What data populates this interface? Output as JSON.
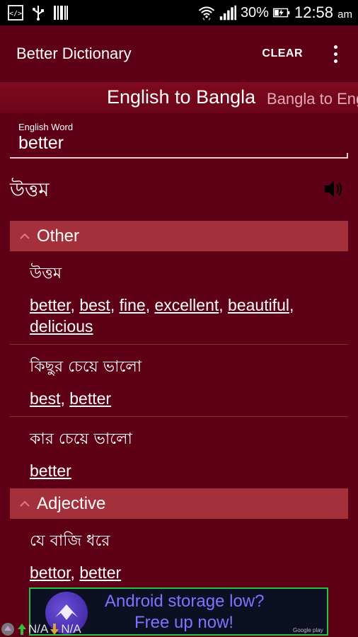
{
  "status_bar": {
    "battery": "30%",
    "time": "12:58",
    "ampm": "am"
  },
  "app_bar": {
    "title": "Better Dictionary",
    "clear_label": "CLEAR"
  },
  "tabs": {
    "active": "English to Bangla",
    "inactive": "Bangla to Eng"
  },
  "search": {
    "label": "English Word",
    "value": "better"
  },
  "main_meaning": "উত্তম",
  "sections": [
    {
      "title": "Other",
      "entries": [
        {
          "bn": "উত্তম",
          "en": [
            "better",
            "best",
            "fine",
            "excellent",
            "beautiful",
            "delicious"
          ]
        },
        {
          "bn": "কিছুর চেয়ে ভালো",
          "en": [
            "best",
            "better"
          ]
        },
        {
          "bn": "কার চেয়ে ভালো",
          "en": [
            "better"
          ]
        }
      ]
    },
    {
      "title": "Adjective",
      "entries": [
        {
          "bn": "যে বাজি ধরে",
          "en": [
            "bettor",
            "better"
          ]
        }
      ]
    }
  ],
  "ad": {
    "line1": "Android storage low?",
    "line2": "Free up now!",
    "badge": "Google play"
  },
  "traffic": {
    "up": "N/A",
    "down": "N/A"
  },
  "colors": {
    "background": "#5e0016",
    "section_header": "#a3303b",
    "accent_underline": "#f2c9d0"
  }
}
